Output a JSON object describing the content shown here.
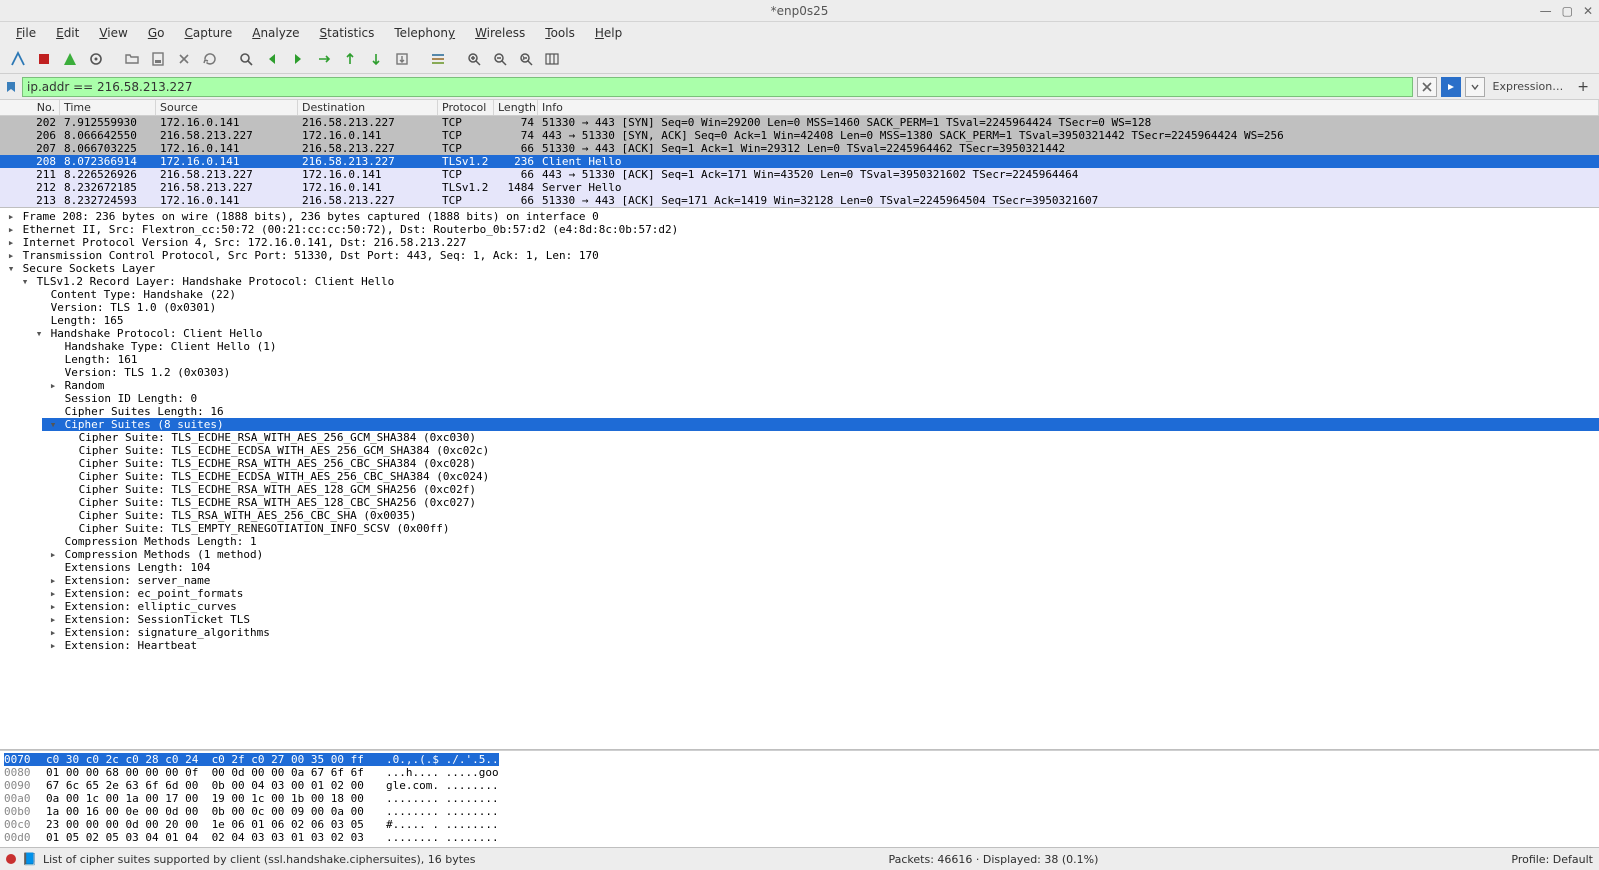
{
  "window": {
    "title": "*enp0s25"
  },
  "menu": {
    "file": "File",
    "edit": "Edit",
    "view": "View",
    "go": "Go",
    "capture": "Capture",
    "analyze": "Analyze",
    "statistics": "Statistics",
    "telephony": "Telephony",
    "wireless": "Wireless",
    "tools": "Tools",
    "help": "Help"
  },
  "filter": {
    "value": "ip.addr == 216.58.213.227",
    "expression_label": "Expression…"
  },
  "packet_list": {
    "columns": {
      "no": "No.",
      "time": "Time",
      "source": "Source",
      "destination": "Destination",
      "protocol": "Protocol",
      "length": "Length",
      "info": "Info"
    },
    "rows": [
      {
        "no": "202",
        "time": "7.912559930",
        "source": "172.16.0.141",
        "destination": "216.58.213.227",
        "protocol": "TCP",
        "length": "74",
        "info": "51330 → 443 [SYN] Seq=0 Win=29200 Len=0 MSS=1460 SACK_PERM=1 TSval=2245964424 TSecr=0 WS=128",
        "style": "gray"
      },
      {
        "no": "206",
        "time": "8.066642550",
        "source": "216.58.213.227",
        "destination": "172.16.0.141",
        "protocol": "TCP",
        "length": "74",
        "info": "443 → 51330 [SYN, ACK] Seq=0 Ack=1 Win=42408 Len=0 MSS=1380 SACK_PERM=1 TSval=3950321442 TSecr=2245964424 WS=256",
        "style": "gray"
      },
      {
        "no": "207",
        "time": "8.066703225",
        "source": "172.16.0.141",
        "destination": "216.58.213.227",
        "protocol": "TCP",
        "length": "66",
        "info": "51330 → 443 [ACK] Seq=1 Ack=1 Win=29312 Len=0 TSval=2245964462 TSecr=3950321442",
        "style": "gray"
      },
      {
        "no": "208",
        "time": "8.072366914",
        "source": "172.16.0.141",
        "destination": "216.58.213.227",
        "protocol": "TLSv1.2",
        "length": "236",
        "info": "Client Hello",
        "style": "sel"
      },
      {
        "no": "211",
        "time": "8.226526926",
        "source": "216.58.213.227",
        "destination": "172.16.0.141",
        "protocol": "TCP",
        "length": "66",
        "info": "443 → 51330 [ACK] Seq=1 Ack=171 Win=43520 Len=0 TSval=3950321602 TSecr=2245964464",
        "style": "lav"
      },
      {
        "no": "212",
        "time": "8.232672185",
        "source": "216.58.213.227",
        "destination": "172.16.0.141",
        "protocol": "TLSv1.2",
        "length": "1484",
        "info": "Server Hello",
        "style": "lav"
      },
      {
        "no": "213",
        "time": "8.232724593",
        "source": "172.16.0.141",
        "destination": "216.58.213.227",
        "protocol": "TCP",
        "length": "66",
        "info": "51330 → 443 [ACK] Seq=171 Ack=1419 Win=32128 Len=0 TSval=2245964504 TSecr=3950321607",
        "style": "lav"
      }
    ]
  },
  "details": {
    "nodes": [
      {
        "indent": 0,
        "toggle": "▸",
        "text": "Frame 208: 236 bytes on wire (1888 bits), 236 bytes captured (1888 bits) on interface 0"
      },
      {
        "indent": 0,
        "toggle": "▸",
        "text": "Ethernet II, Src: Flextron_cc:50:72 (00:21:cc:cc:50:72), Dst: Routerbo_0b:57:d2 (e4:8d:8c:0b:57:d2)"
      },
      {
        "indent": 0,
        "toggle": "▸",
        "text": "Internet Protocol Version 4, Src: 172.16.0.141, Dst: 216.58.213.227"
      },
      {
        "indent": 0,
        "toggle": "▸",
        "text": "Transmission Control Protocol, Src Port: 51330, Dst Port: 443, Seq: 1, Ack: 1, Len: 170"
      },
      {
        "indent": 0,
        "toggle": "▾",
        "text": "Secure Sockets Layer"
      },
      {
        "indent": 1,
        "toggle": "▾",
        "text": "TLSv1.2 Record Layer: Handshake Protocol: Client Hello"
      },
      {
        "indent": 2,
        "toggle": " ",
        "text": "Content Type: Handshake (22)"
      },
      {
        "indent": 2,
        "toggle": " ",
        "text": "Version: TLS 1.0 (0x0301)"
      },
      {
        "indent": 2,
        "toggle": " ",
        "text": "Length: 165"
      },
      {
        "indent": 2,
        "toggle": "▾",
        "text": "Handshake Protocol: Client Hello"
      },
      {
        "indent": 3,
        "toggle": " ",
        "text": "Handshake Type: Client Hello (1)"
      },
      {
        "indent": 3,
        "toggle": " ",
        "text": "Length: 161"
      },
      {
        "indent": 3,
        "toggle": " ",
        "text": "Version: TLS 1.2 (0x0303)"
      },
      {
        "indent": 3,
        "toggle": "▸",
        "text": "Random"
      },
      {
        "indent": 3,
        "toggle": " ",
        "text": "Session ID Length: 0"
      },
      {
        "indent": 3,
        "toggle": " ",
        "text": "Cipher Suites Length: 16"
      },
      {
        "indent": 3,
        "toggle": "▾",
        "text": "Cipher Suites (8 suites)",
        "sel": true
      },
      {
        "indent": 4,
        "toggle": " ",
        "text": "Cipher Suite: TLS_ECDHE_RSA_WITH_AES_256_GCM_SHA384 (0xc030)"
      },
      {
        "indent": 4,
        "toggle": " ",
        "text": "Cipher Suite: TLS_ECDHE_ECDSA_WITH_AES_256_GCM_SHA384 (0xc02c)"
      },
      {
        "indent": 4,
        "toggle": " ",
        "text": "Cipher Suite: TLS_ECDHE_RSA_WITH_AES_256_CBC_SHA384 (0xc028)"
      },
      {
        "indent": 4,
        "toggle": " ",
        "text": "Cipher Suite: TLS_ECDHE_ECDSA_WITH_AES_256_CBC_SHA384 (0xc024)"
      },
      {
        "indent": 4,
        "toggle": " ",
        "text": "Cipher Suite: TLS_ECDHE_RSA_WITH_AES_128_GCM_SHA256 (0xc02f)"
      },
      {
        "indent": 4,
        "toggle": " ",
        "text": "Cipher Suite: TLS_ECDHE_RSA_WITH_AES_128_CBC_SHA256 (0xc027)"
      },
      {
        "indent": 4,
        "toggle": " ",
        "text": "Cipher Suite: TLS_RSA_WITH_AES_256_CBC_SHA (0x0035)"
      },
      {
        "indent": 4,
        "toggle": " ",
        "text": "Cipher Suite: TLS_EMPTY_RENEGOTIATION_INFO_SCSV (0x00ff)"
      },
      {
        "indent": 3,
        "toggle": " ",
        "text": "Compression Methods Length: 1"
      },
      {
        "indent": 3,
        "toggle": "▸",
        "text": "Compression Methods (1 method)"
      },
      {
        "indent": 3,
        "toggle": " ",
        "text": "Extensions Length: 104"
      },
      {
        "indent": 3,
        "toggle": "▸",
        "text": "Extension: server_name"
      },
      {
        "indent": 3,
        "toggle": "▸",
        "text": "Extension: ec_point_formats"
      },
      {
        "indent": 3,
        "toggle": "▸",
        "text": "Extension: elliptic_curves"
      },
      {
        "indent": 3,
        "toggle": "▸",
        "text": "Extension: SessionTicket TLS"
      },
      {
        "indent": 3,
        "toggle": "▸",
        "text": "Extension: signature_algorithms"
      },
      {
        "indent": 3,
        "toggle": "▸",
        "text": "Extension: Heartbeat"
      }
    ]
  },
  "hex": {
    "rows": [
      {
        "off": "0070",
        "bytes_hl": "c0 30 c0 2c c0 28 c0 24  c0 2f c0 27 00 35 00 ff",
        "ascii_hl": ".0.,.(.$ ./.'.5..",
        "hl": true
      },
      {
        "off": "0080",
        "bytes": "01 00 00 68 00 00 00 0f  00 0d 00 00 0a 67 6f 6f",
        "ascii": "...h.... .....goo"
      },
      {
        "off": "0090",
        "bytes": "67 6c 65 2e 63 6f 6d 00  0b 00 04 03 00 01 02 00",
        "ascii": "gle.com. ........"
      },
      {
        "off": "00a0",
        "bytes": "0a 00 1c 00 1a 00 17 00  19 00 1c 00 1b 00 18 00",
        "ascii": "........ ........"
      },
      {
        "off": "00b0",
        "bytes": "1a 00 16 00 0e 00 0d 00  0b 00 0c 00 09 00 0a 00",
        "ascii": "........ ........"
      },
      {
        "off": "00c0",
        "bytes": "23 00 00 00 0d 00 20 00  1e 06 01 06 02 06 03 05",
        "ascii": "#..... . ........"
      },
      {
        "off": "00d0",
        "bytes": "01 05 02 05 03 04 01 04  02 04 03 03 01 03 02 03",
        "ascii": "........ ........"
      }
    ]
  },
  "status": {
    "left": "List of cipher suites supported by client (ssl.handshake.ciphersuites), 16 bytes",
    "packets": "Packets: 46616 · Displayed: 38 (0.1%)",
    "profile": "Profile: Default"
  }
}
